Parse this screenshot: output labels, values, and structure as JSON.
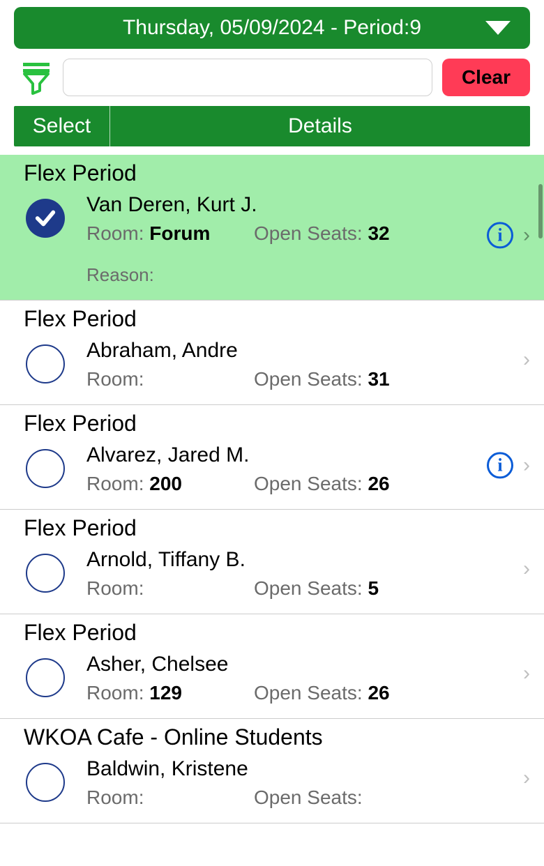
{
  "header": {
    "date_period": "Thursday, 05/09/2024 - Period:9"
  },
  "filter": {
    "search_value": "",
    "search_placeholder": "",
    "clear_label": "Clear"
  },
  "columns": {
    "select": "Select",
    "details": "Details"
  },
  "labels": {
    "room": "Room:",
    "open_seats": "Open Seats:",
    "reason": "Reason:",
    "info": "i",
    "chevron": "›"
  },
  "items": [
    {
      "period": "Flex Period",
      "teacher": "Van Deren, Kurt J.",
      "room": "Forum",
      "open_seats": "32",
      "selected": true,
      "has_info": true,
      "show_reason": true,
      "reason": ""
    },
    {
      "period": "Flex Period",
      "teacher": "Abraham, Andre",
      "room": "",
      "open_seats": "31",
      "selected": false,
      "has_info": false,
      "show_reason": false
    },
    {
      "period": "Flex Period",
      "teacher": "Alvarez, Jared M.",
      "room": "200",
      "open_seats": "26",
      "selected": false,
      "has_info": true,
      "show_reason": false
    },
    {
      "period": "Flex Period",
      "teacher": "Arnold, Tiffany B.",
      "room": "",
      "open_seats": "5",
      "selected": false,
      "has_info": false,
      "show_reason": false
    },
    {
      "period": "Flex Period",
      "teacher": "Asher, Chelsee",
      "room": "129",
      "open_seats": "26",
      "selected": false,
      "has_info": false,
      "show_reason": false
    },
    {
      "period": "WKOA Cafe - Online Students",
      "teacher": "Baldwin, Kristene",
      "room": "",
      "open_seats": "",
      "selected": false,
      "has_info": false,
      "show_reason": false
    }
  ]
}
